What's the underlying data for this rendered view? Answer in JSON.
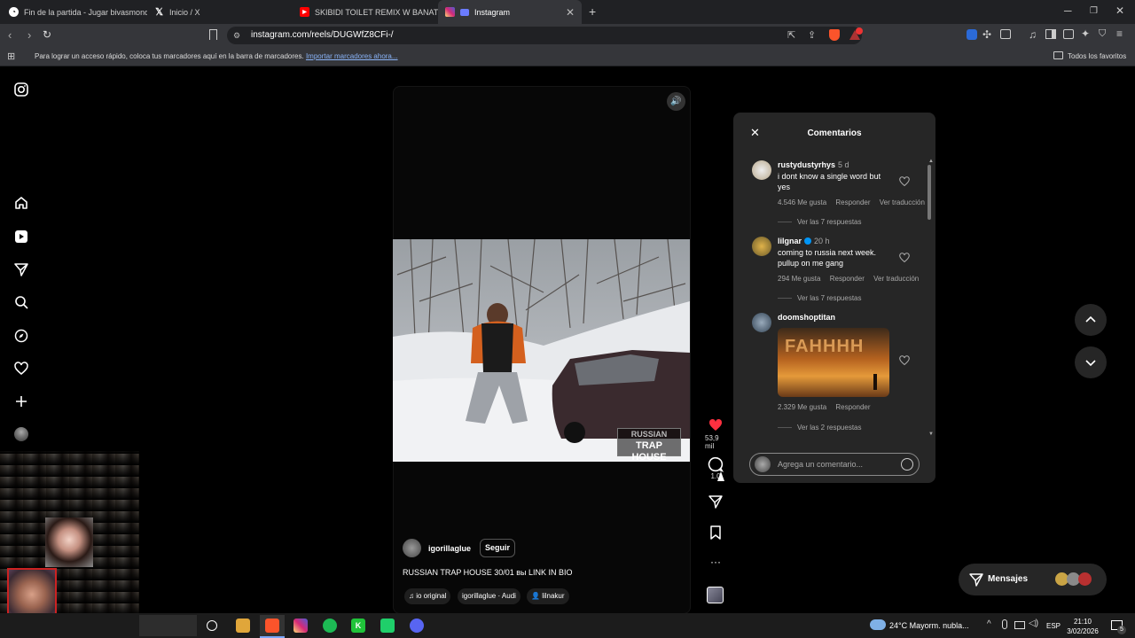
{
  "tabs": [
    {
      "label": "Fin de la partida - Jugar bivasmonda!"
    },
    {
      "label": "Inicio / X"
    },
    {
      "label": "SKIBIDI TOILET REMIX W BANATROLL"
    },
    {
      "label": "Instagram"
    }
  ],
  "address": {
    "url": "instagram.com/reels/DUGWfZ8CFi-/"
  },
  "bookmarks": {
    "hint": "Para lograr un acceso rápido, coloca tus marcadores aquí en la barra de marcadores.",
    "import_link": "Importar marcadores ahora...",
    "all_favorites": "Todos los favoritos"
  },
  "reel": {
    "video_watermark_line1": "RUSSIAN",
    "video_watermark_line2": "TRAP HOUSE",
    "likes": "53,9 mil",
    "comments_count": "1.0",
    "author": "igorillaglue",
    "follow_label": "Seguir",
    "caption": "RUSSIAN TRAP HOUSE 30/01 вы LINK IN BIO",
    "audio_label": "io original",
    "audio_author": "igorillaglue · Audi",
    "tagged_user": "lilnakur"
  },
  "comments_panel": {
    "title": "Comentarios",
    "input_placeholder": "Agrega un comentario...",
    "comments": [
      {
        "user": "rustydustyrhys",
        "time": "5 d",
        "text": "i dont know a single word but yes",
        "likes": "4.546 Me gusta",
        "reply": "Responder",
        "translate": "Ver traducción",
        "replies": "Ver las 7 respuestas"
      },
      {
        "user": "lilgnar",
        "time": "20 h",
        "text": "coming to russia next week. pullup on me gang",
        "likes": "294 Me gusta",
        "reply": "Responder",
        "translate": "Ver traducción",
        "replies": "Ver las 7 respuestas"
      },
      {
        "user": "doomshoptitan",
        "time": "",
        "text": "",
        "image_text": "FAHHHH",
        "likes": "2.329 Me gusta",
        "reply": "Responder",
        "translate": "",
        "replies": "Ver las 2 respuestas"
      }
    ]
  },
  "messages": {
    "label": "Mensajes"
  },
  "taskbar": {
    "weather": "24°C  Mayorm. nubla...",
    "lang": "ESP",
    "time": "21:10",
    "date": "3/02/2026",
    "notif_count": "5"
  },
  "colors": {
    "like_red": "#ff3040",
    "verified_blue": "#0095f6",
    "brave_orange": "#fb542b",
    "instagram_pink": "#d6249f",
    "spotify_green": "#1db954"
  }
}
